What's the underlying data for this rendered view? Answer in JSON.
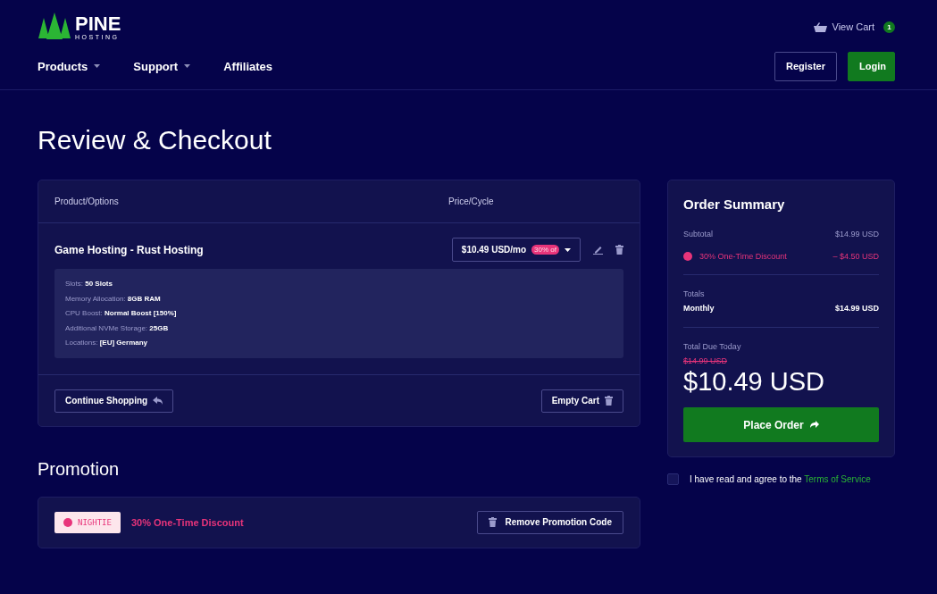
{
  "logo": {
    "name": "PINE",
    "tagline": "HOSTING"
  },
  "cart_link": {
    "label": "View Cart",
    "count": "1"
  },
  "nav": [
    {
      "label": "Products",
      "dropdown": true
    },
    {
      "label": "Support",
      "dropdown": true
    },
    {
      "label": "Affiliates",
      "dropdown": false
    }
  ],
  "auth_buttons": [
    {
      "label": "Register",
      "kind": "outline"
    },
    {
      "label": "Login",
      "kind": "primary"
    }
  ],
  "page_title": "Review & Checkout",
  "cart": {
    "columns": [
      "Product/Options",
      "Price/Cycle"
    ],
    "items": [
      {
        "name": "Game Hosting - Rust Hosting",
        "price": "$10.49 USD/mo",
        "badge": "30% of",
        "options": [
          {
            "label": "Slots:",
            "value": "50 Slots"
          },
          {
            "label": "Memory Allocation:",
            "value": "8GB RAM"
          },
          {
            "label": "CPU Boost:",
            "value": "Normal Boost [150%]"
          },
          {
            "label": "Additional NVMe Storage:",
            "value": "25GB"
          },
          {
            "label": "Locations:",
            "value": "[EU] Germany"
          }
        ]
      }
    ],
    "continue_button": "Continue Shopping",
    "empty_button": "Empty Cart"
  },
  "promotion": {
    "title": "Promotion",
    "code": "NIGHTIE",
    "description": "30% One-Time Discount",
    "remove_button": "Remove Promotion Code"
  },
  "summary": {
    "title": "Order Summary",
    "lines": [
      {
        "label": "Subtotal",
        "value": "$14.99 USD",
        "kind": "plain"
      },
      {
        "label": "30% One-Time Discount",
        "value": "– $4.50 USD",
        "kind": "discount"
      }
    ],
    "totals_label": "Totals",
    "totals": [
      {
        "label": "Monthly",
        "value": "$14.99 USD"
      }
    ],
    "due_label": "Total Due Today",
    "old_total": "$14.99 USD",
    "total": "$10.49 USD",
    "place_order": "Place Order"
  },
  "terms": {
    "checked": false,
    "text": "I have read and agree to the ",
    "link": "Terms of Service"
  }
}
